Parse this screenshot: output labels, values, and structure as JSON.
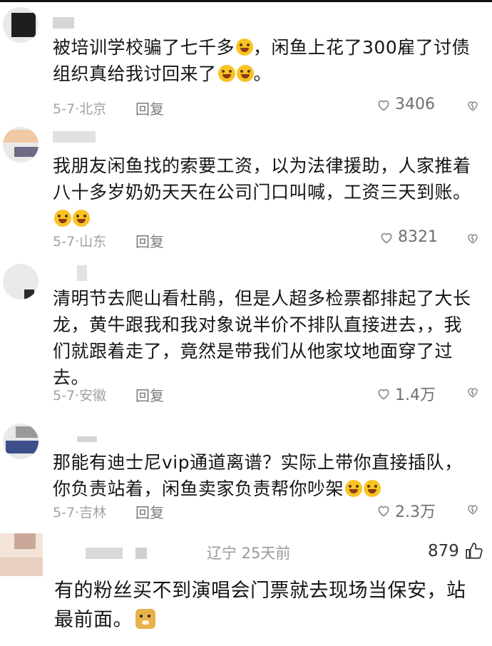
{
  "comments": [
    {
      "text": "被培训学校骗了七千多",
      "text_tail": "，闲鱼上花了300雇了讨债组织真给我讨回来了",
      "text_end": "。",
      "date_loc": "5-7·北京",
      "reply": "回复",
      "likes": "3406"
    },
    {
      "text": "我朋友闲鱼找的索要工资，以为法律援助，人家推着八十多岁奶奶天天在公司门口叫喊，工资三天到账。",
      "date_loc": "5-7·山东",
      "reply": "回复",
      "likes": "8321"
    },
    {
      "text": "清明节去爬山看杜鹃，但是人超多检票都排起了大长龙，黄牛跟我和我对象说半价不排队直接进去，，我们就跟着走了，竟然是带我们从他家坟地面穿了过去。",
      "date_loc": "5-7·安徽",
      "reply": "回复",
      "likes": "1.4万"
    },
    {
      "text": "那能有迪士尼vip通道离谱？实际上带你直接插队，你负责站着，闲鱼卖家负责帮你吵架",
      "date_loc": "5-7·吉林",
      "reply": "回复",
      "likes": "2.3万"
    },
    {
      "location_time": "辽宁 25天前",
      "likes": "879",
      "text": "有的粉丝买不到演唱会门票就去现场当保安，站最前面。"
    }
  ],
  "icons": {
    "heart": "heart-outline-icon",
    "dislike": "heart-broken-icon",
    "thumb": "thumbs-up-icon",
    "emoji_cry": "crying-face-icon",
    "emoji_laugh": "rofl-face-icon",
    "emoji_grin": "grin-face-icon",
    "emoji_doge": "doge-face-icon"
  },
  "colors": {
    "text": "#151515",
    "meta": "#a2a2a2",
    "avatar_placeholder": "#e9e9e9"
  }
}
